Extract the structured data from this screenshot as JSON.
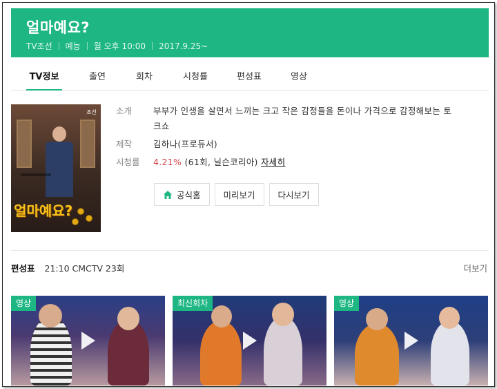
{
  "program": {
    "title": "얼마예요?",
    "channel": "TV조선",
    "genre": "예능",
    "schedule": "월 오후 10:00",
    "start": "2017.9.25~"
  },
  "tabs": [
    {
      "label": "TV정보",
      "active": true
    },
    {
      "label": "출연",
      "active": false
    },
    {
      "label": "회차",
      "active": false
    },
    {
      "label": "시청률",
      "active": false
    },
    {
      "label": "편성표",
      "active": false
    },
    {
      "label": "영상",
      "active": false
    }
  ],
  "poster": {
    "logo_text": "얼마예요?",
    "channel_mark": "조선"
  },
  "info": {
    "intro_label": "소개",
    "intro_text": "부부가 인생을 살면서 느끼는 크고 작은 감정들을 돈이나 가격으로 감정해보는 토크쇼",
    "producer_label": "제작",
    "producer_text": "김하나(프로듀서)",
    "rating_label": "시청률",
    "rating_value": "4.21%",
    "rating_rest": "(61회, 닐슨코리아)",
    "rating_link": "자세히"
  },
  "buttons": {
    "official": "공식홈",
    "preview": "미리보기",
    "replay": "다시보기"
  },
  "schedule_bar": {
    "heading": "편성표",
    "text": "21:10 CMCTV 23회",
    "more": "더보기"
  },
  "videos": [
    {
      "badge": "영상",
      "caption": ""
    },
    {
      "badge": "최신회차",
      "caption": ""
    },
    {
      "badge": "영상",
      "caption": ""
    }
  ],
  "colors": {
    "accent": "#1eb784",
    "rating": "#d2454b"
  },
  "icons": {
    "home": "home-icon",
    "play": "play-icon"
  }
}
